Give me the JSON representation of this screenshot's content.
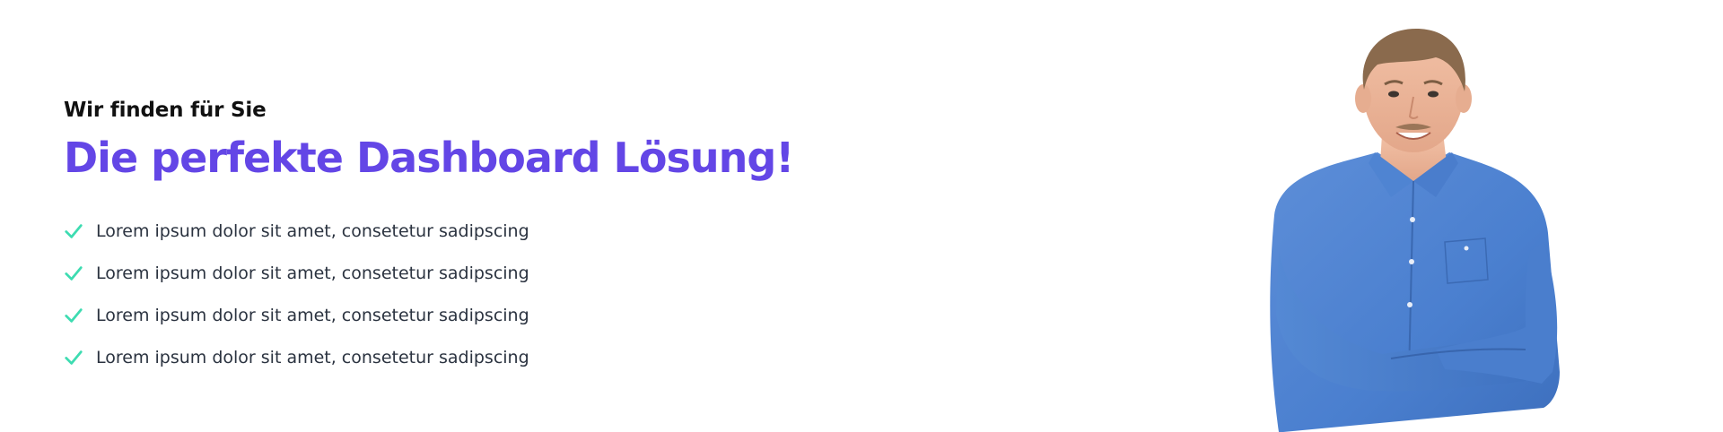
{
  "hero": {
    "subtitle": "Wir finden für Sie",
    "headline": "Die perfekte Dashboard Lösung!",
    "accent_color": "#6346e6",
    "check_color": "#3ddcb1",
    "features": [
      {
        "text": "Lorem ipsum dolor sit amet, consetetur sadipscing",
        "icon": "check-icon"
      },
      {
        "text": "Lorem ipsum dolor sit amet, consetetur sadipscing",
        "icon": "check-icon"
      },
      {
        "text": "Lorem ipsum dolor sit amet, consetetur sadipscing",
        "icon": "check-icon"
      },
      {
        "text": "Lorem ipsum dolor sit amet, consetetur sadipscing",
        "icon": "check-icon"
      }
    ],
    "portrait": "man-in-blue-shirt-arms-crossed"
  }
}
